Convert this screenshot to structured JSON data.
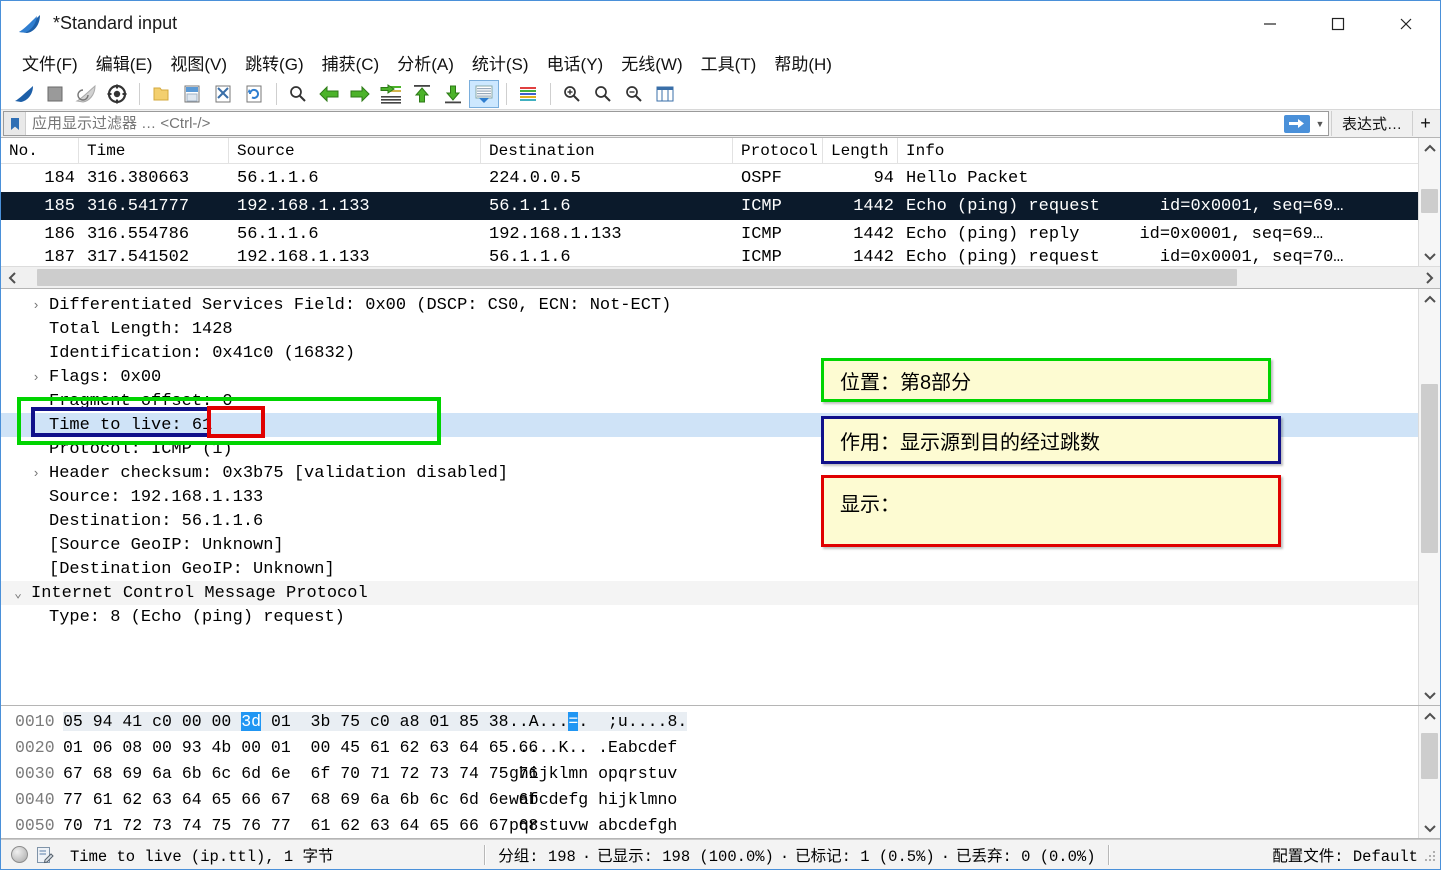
{
  "window": {
    "title": "*Standard input",
    "app_icon": "wireshark-fin-icon",
    "minimize_label": "—",
    "maximize_label": "□",
    "close_label": "✕"
  },
  "menubar": {
    "items": [
      {
        "label": "文件(F)",
        "name": "menu-file"
      },
      {
        "label": "编辑(E)",
        "name": "menu-edit"
      },
      {
        "label": "视图(V)",
        "name": "menu-view"
      },
      {
        "label": "跳转(G)",
        "name": "menu-go"
      },
      {
        "label": "捕获(C)",
        "name": "menu-capture"
      },
      {
        "label": "分析(A)",
        "name": "menu-analyze"
      },
      {
        "label": "统计(S)",
        "name": "menu-statistics"
      },
      {
        "label": "电话(Y)",
        "name": "menu-telephony"
      },
      {
        "label": "无线(W)",
        "name": "menu-wireless"
      },
      {
        "label": "工具(T)",
        "name": "menu-tools"
      },
      {
        "label": "帮助(H)",
        "name": "menu-help"
      }
    ]
  },
  "toolbar": {
    "buttons": [
      "start-capture-icon",
      "stop-capture-icon",
      "restart-capture-icon",
      "capture-options-icon",
      "open-file-icon",
      "save-file-icon",
      "close-file-icon",
      "reload-file-icon",
      "find-packet-icon",
      "go-back-icon",
      "go-forward-icon",
      "go-to-packet-icon",
      "go-first-packet-icon",
      "go-last-packet-icon",
      "auto-scroll-icon",
      "colorize-icon",
      "zoom-in-icon",
      "zoom-out-icon",
      "zoom-reset-icon",
      "resize-columns-icon"
    ]
  },
  "filter": {
    "bookmark_icon": "bookmark-icon",
    "placeholder": "应用显示过滤器 … <Ctrl-/>",
    "value": "",
    "apply_icon": "apply-filter-arrow-icon",
    "dropdown_icon": "chevron-down-icon",
    "expression_label": "表达式…",
    "plus_label": "+"
  },
  "packet_list": {
    "columns": [
      "No.",
      "Time",
      "Source",
      "Destination",
      "Protocol",
      "Length",
      "Info"
    ],
    "rows": [
      {
        "no": "184",
        "time": "316.380663",
        "source": "56.1.1.6",
        "destination": "224.0.0.5",
        "protocol": "OSPF",
        "length": "94",
        "info": "Hello Packet",
        "info_extra": "",
        "selected": false
      },
      {
        "no": "185",
        "time": "316.541777",
        "source": "192.168.1.133",
        "destination": "56.1.1.6",
        "protocol": "ICMP",
        "length": "1442",
        "info": "Echo (ping) request",
        "info_extra": "id=0x0001, seq=69…",
        "selected": true
      },
      {
        "no": "186",
        "time": "316.554786",
        "source": "56.1.1.6",
        "destination": "192.168.1.133",
        "protocol": "ICMP",
        "length": "1442",
        "info": "Echo (ping) reply",
        "info_extra": "id=0x0001, seq=69…",
        "selected": false
      },
      {
        "no": "187",
        "time": "317.541502",
        "source": "192.168.1.133",
        "destination": "56.1.1.6",
        "protocol": "ICMP",
        "length": "1442",
        "info": "Echo (ping) request",
        "info_extra": "id=0x0001, seq=70…",
        "selected": false
      }
    ]
  },
  "packet_details": {
    "lines": [
      {
        "text": "Differentiated Services Field: 0x00 (DSCP: CS0, ECN: Not-ECT)",
        "twisty": "right",
        "highlight": false,
        "indent": 1
      },
      {
        "text": "Total Length: 1428",
        "twisty": "",
        "highlight": false,
        "indent": 1
      },
      {
        "text": "Identification: 0x41c0 (16832)",
        "twisty": "",
        "highlight": false,
        "indent": 1
      },
      {
        "text": "Flags: 0x00",
        "twisty": "right",
        "highlight": false,
        "indent": 1
      },
      {
        "text": "Fragment offset: 0",
        "twisty": "",
        "highlight": false,
        "indent": 1
      },
      {
        "text": "Time to live: 61",
        "twisty": "",
        "highlight": true,
        "indent": 1
      },
      {
        "text": "Protocol: ICMP (1)",
        "twisty": "",
        "highlight": false,
        "indent": 1
      },
      {
        "text": "Header checksum: 0x3b75 [validation disabled]",
        "twisty": "right",
        "highlight": false,
        "indent": 1
      },
      {
        "text": "Source: 192.168.1.133",
        "twisty": "",
        "highlight": false,
        "indent": 1
      },
      {
        "text": "Destination: 56.1.1.6",
        "twisty": "",
        "highlight": false,
        "indent": 1
      },
      {
        "text": "[Source GeoIP: Unknown]",
        "twisty": "",
        "highlight": false,
        "indent": 1
      },
      {
        "text": "[Destination GeoIP: Unknown]",
        "twisty": "",
        "highlight": false,
        "indent": 1
      },
      {
        "text": "Internet Control Message Protocol",
        "twisty": "down",
        "highlight": false,
        "indent": 0
      },
      {
        "text": "Type: 8 (Echo (ping) request)",
        "twisty": "",
        "highlight": false,
        "indent": 1
      }
    ]
  },
  "annotations": {
    "boxes": [
      {
        "text": "位置：第8部分",
        "color": "#00d400",
        "name": "annotation-position"
      },
      {
        "text": "作用：显示源到目的经过跳数",
        "color": "#10108a",
        "name": "annotation-purpose"
      },
      {
        "text": "显示：",
        "color": "#e00000",
        "name": "annotation-display"
      }
    ],
    "highlight_rects": [
      {
        "color": "#00d400",
        "name": "highlight-ttl-row-green"
      },
      {
        "color": "#10108a",
        "name": "highlight-ttl-label-navy"
      },
      {
        "color": "#e00000",
        "name": "highlight-ttl-value-red"
      }
    ]
  },
  "hex_dump": {
    "rows": [
      {
        "offset": "0010",
        "bytes_pre": "05 94 41 c0 00 00 ",
        "bytes_sel": "3d",
        "bytes_post": " 01  3b 75 c0 a8 01 85 38 01",
        "ascii_pre": "..A...",
        "ascii_sel": "=",
        "ascii_post": ".  ;u....8."
      },
      {
        "offset": "0020",
        "bytes_pre": "01 06 08 00 93 4b 00 01  00 45 61 62 63 64 65 66",
        "bytes_sel": "",
        "bytes_post": "",
        "ascii_pre": ".....K.. .Eabcdef",
        "ascii_sel": "",
        "ascii_post": ""
      },
      {
        "offset": "0030",
        "bytes_pre": "67 68 69 6a 6b 6c 6d 6e  6f 70 71 72 73 74 75 76",
        "bytes_sel": "",
        "bytes_post": "",
        "ascii_pre": "ghijklmn opqrstuv",
        "ascii_sel": "",
        "ascii_post": ""
      },
      {
        "offset": "0040",
        "bytes_pre": "77 61 62 63 64 65 66 67  68 69 6a 6b 6c 6d 6e 6f",
        "bytes_sel": "",
        "bytes_post": "",
        "ascii_pre": "wabcdefg hijklmno",
        "ascii_sel": "",
        "ascii_post": ""
      },
      {
        "offset": "0050",
        "bytes_pre": "70 71 72 73 74 75 76 77  61 62 63 64 65 66 67 68",
        "bytes_sel": "",
        "bytes_post": "",
        "ascii_pre": "pqrstuvw abcdefgh",
        "ascii_sel": "",
        "ascii_post": ""
      }
    ]
  },
  "statusbar": {
    "expert_icon": "expert-info-icon",
    "capture_icon": "capture-file-properties-icon",
    "field_text": "Time to live (ip.ttl), 1 字节",
    "packets_label": "分组: 198",
    "displayed_label": "已显示: 198 (100.0%)",
    "marked_label": "已标记: 1 (0.5%)",
    "dropped_label": "已丢弃: 0 (0.0%)",
    "profile_label": "配置文件: Default",
    "separator": "·"
  },
  "colors": {
    "selected_row_bg": "#0b1a2b",
    "field_highlight_bg": "#cfe3f7",
    "hex_selection_bg": "#2196f3",
    "annotation_bg": "#fdfbd2",
    "window_border": "#4a90d9"
  }
}
